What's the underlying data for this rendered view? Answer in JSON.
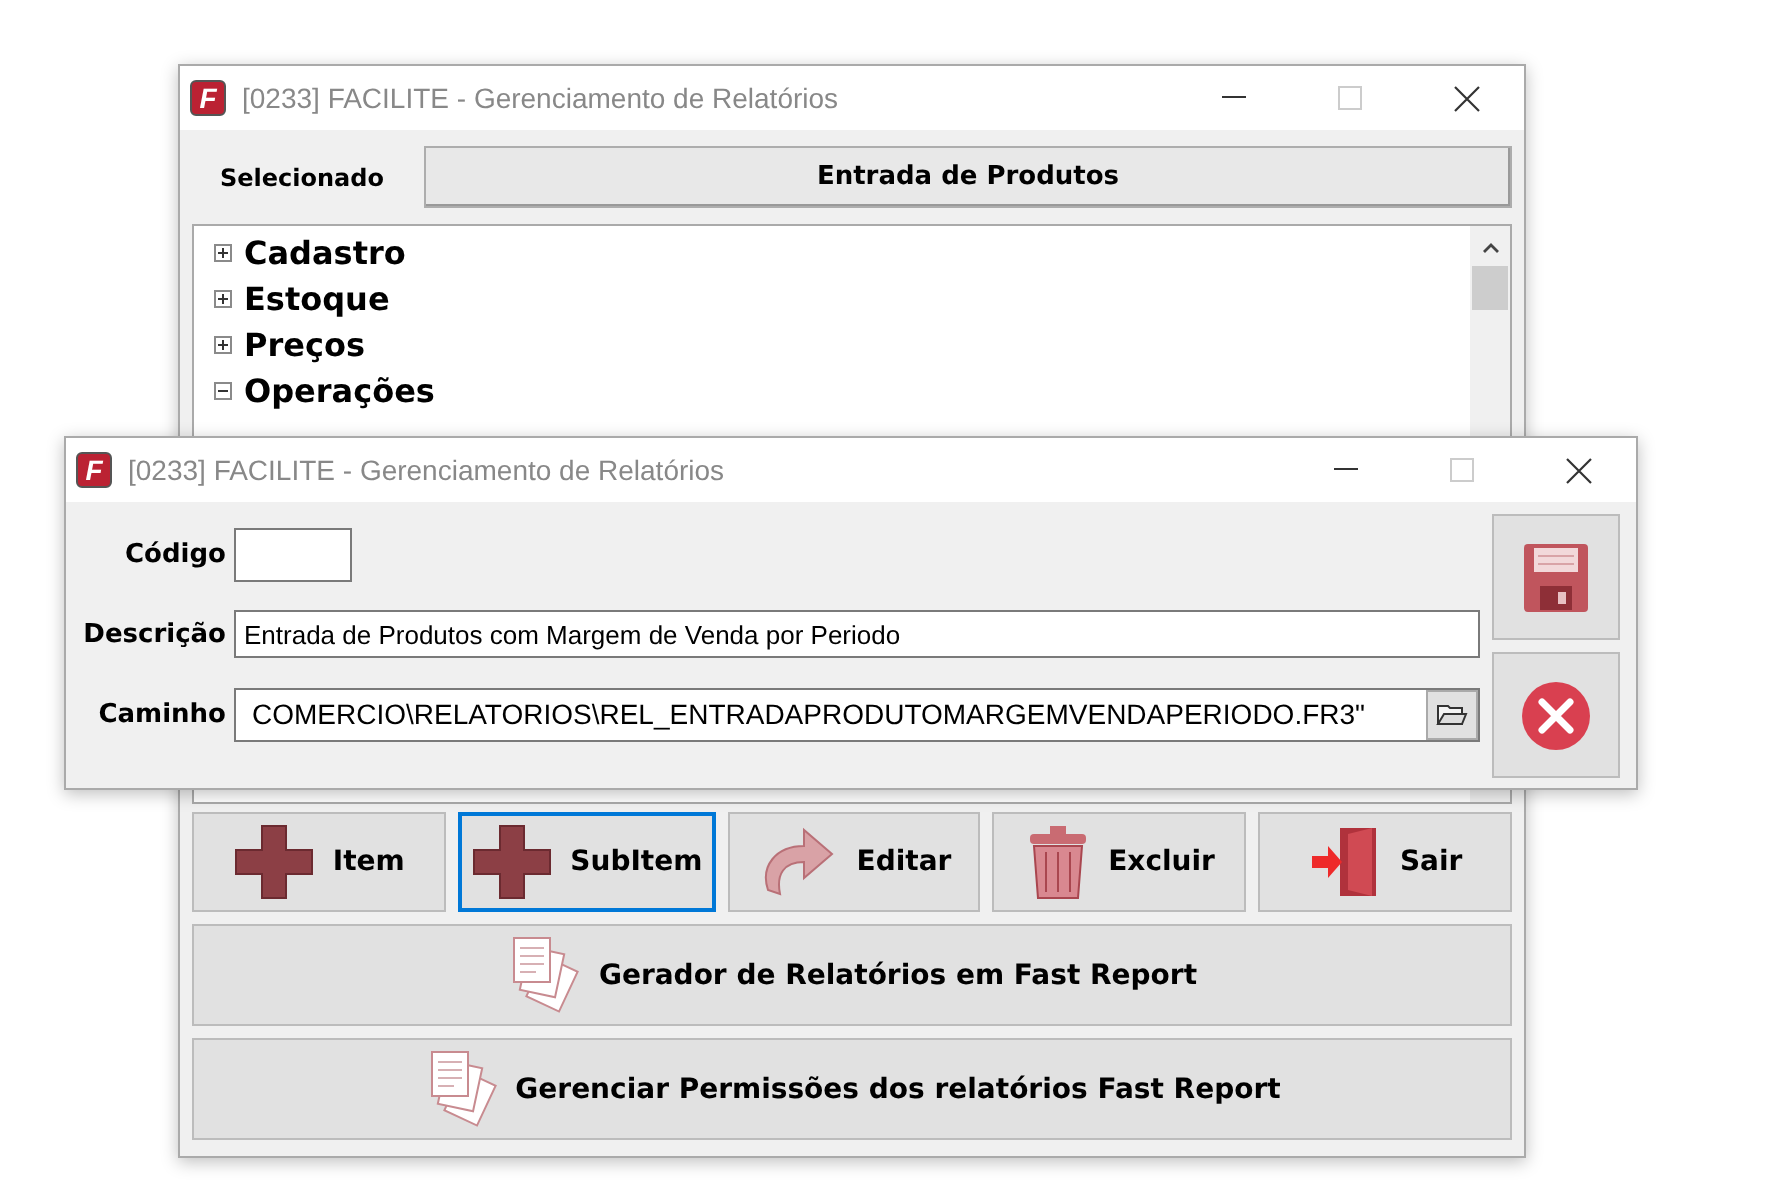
{
  "main_window": {
    "logo": "F",
    "title": "[0233] FACILITE - Gerenciamento de Relatórios",
    "selected_label": "Selecionado",
    "selected_value": "Entrada de Produtos",
    "tree": [
      {
        "label": "Cadastro",
        "expanded": false
      },
      {
        "label": "Estoque",
        "expanded": false
      },
      {
        "label": "Preços",
        "expanded": false
      },
      {
        "label": "Operações",
        "expanded": true
      }
    ],
    "buttons": [
      {
        "label": "Item",
        "kind": "plus",
        "focused": false
      },
      {
        "label": "SubItem",
        "kind": "plus",
        "focused": true
      },
      {
        "label": "Editar",
        "kind": "edit",
        "focused": false
      },
      {
        "label": "Excluir",
        "kind": "trash",
        "focused": false
      },
      {
        "label": "Sair",
        "kind": "exit",
        "focused": false
      }
    ],
    "wide_buttons": [
      "Gerador de Relatórios em Fast Report",
      "Gerenciar Permissões dos relatórios Fast Report"
    ]
  },
  "dialog": {
    "logo": "F",
    "title": "[0233] FACILITE - Gerenciamento de Relatórios",
    "fields": [
      {
        "label": "Código",
        "kind": "short"
      },
      {
        "label": "Descrição",
        "value": "Entrada de Produtos com Margem de Venda por Periodo",
        "kind": "text"
      },
      {
        "label": "Caminho",
        "value": "COMERCIO\\RELATORIOS\\REL_ENTRADAPRODUTOMARGEMVENDAPERIODO.FR3\"",
        "kind": "path"
      }
    ],
    "actions": [
      {
        "kind": "save"
      },
      {
        "kind": "cancel"
      }
    ]
  }
}
